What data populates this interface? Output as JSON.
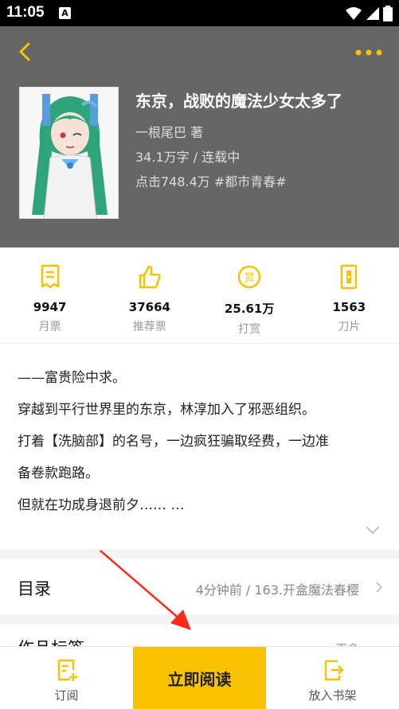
{
  "status": {
    "time": "11:05",
    "notification_icon": "A"
  },
  "book": {
    "title": "东京，战败的魔法少女太多了",
    "author": "一根尾巴 著",
    "words_status": "34.1万字 / 连载中",
    "clicks_category": "点击748.4万 #都市青春#"
  },
  "stats": [
    {
      "icon": "monthly-ticket-icon",
      "value": "9947",
      "label": "月票"
    },
    {
      "icon": "thumbs-up-icon",
      "value": "37664",
      "label": "推荐票"
    },
    {
      "icon": "reward-coin-icon",
      "value": "25.61万",
      "label": "打赏"
    },
    {
      "icon": "blade-icon",
      "value": "1563",
      "label": "刀片"
    }
  ],
  "synopsis": {
    "line1": "——富贵险中求。",
    "line2": "穿越到平行世界里的东京，林淳加入了邪恶组织。",
    "line3": "打着【洗脑部】的名号，一边疯狂骗取经费，一边准",
    "line4": "备卷款跑路。",
    "line5": "但就在功成身退前夕…… …"
  },
  "toc": {
    "label": "目录",
    "latest": "4分钟前 / 163.开盒魔法春樱"
  },
  "tags": {
    "label": "作品标签",
    "more": "更多"
  },
  "bottom": {
    "subscribe": "订阅",
    "read": "立即阅读",
    "shelf": "放入书架"
  },
  "colors": {
    "accent": "#f9c200",
    "header_bg": "#666666",
    "annotation": "#ff2a1a"
  }
}
